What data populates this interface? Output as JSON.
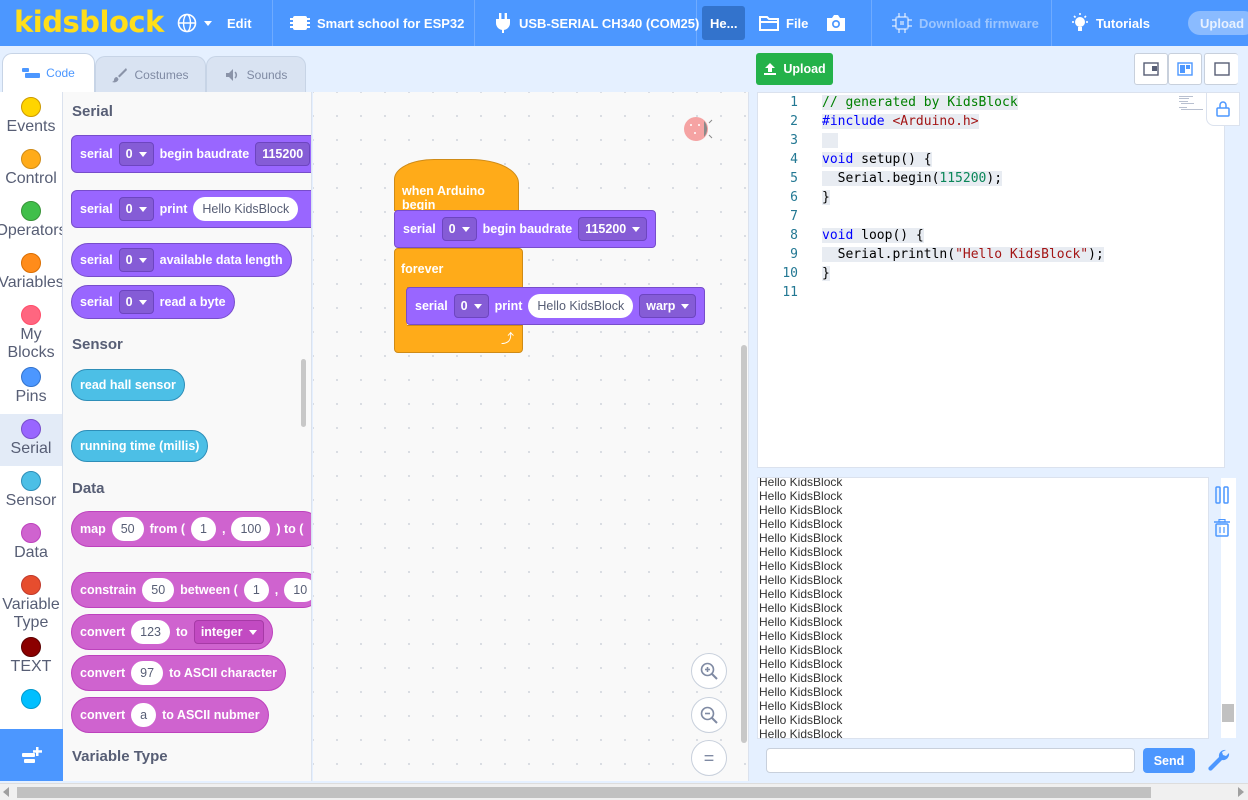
{
  "menubar": {
    "logo": "kidsblock",
    "edit": "Edit",
    "device": "Smart school for ESP32",
    "port": "USB-SERIAL CH340 (COM25)",
    "help": "He...",
    "file": "File",
    "download_firmware": "Download firmware",
    "tutorials": "Tutorials",
    "upload": "Upload",
    "icons": [
      "globe-icon",
      "device-board-icon",
      "usb-plug-icon",
      "folder-icon",
      "camera-icon",
      "chip-icon",
      "lightbulb-icon"
    ]
  },
  "tabs": [
    {
      "label": "Code",
      "icon": "code-icon",
      "active": true
    },
    {
      "label": "Costumes",
      "icon": "brush-icon"
    },
    {
      "label": "Sounds",
      "icon": "speaker-icon"
    }
  ],
  "categories": [
    {
      "label": "Events",
      "color": "#ffd500"
    },
    {
      "label": "Control",
      "color": "#ffab19"
    },
    {
      "label": "Operators",
      "color": "#40bf4a"
    },
    {
      "label": "Variables",
      "color": "#ff8c1a"
    },
    {
      "label": "My Blocks",
      "color": "#ff6680"
    },
    {
      "label": "Pins",
      "color": "#4c97ff"
    },
    {
      "label": "Serial",
      "color": "#9966ff",
      "selected": true
    },
    {
      "label": "Sensor",
      "color": "#4cbfe6"
    },
    {
      "label": "Data",
      "color": "#cf63cf"
    },
    {
      "label": "Variable Type",
      "color": "#e64d2e"
    },
    {
      "label": "TEXT",
      "color": "#8b0000"
    },
    {
      "label": "",
      "color": "#00bfff"
    }
  ],
  "flyout": {
    "serial_heading": "Serial",
    "sensor_heading": "Sensor",
    "data_heading": "Data",
    "vartype_heading": "Variable Type",
    "b_begin": {
      "serial": "serial",
      "port": "0",
      "text": "begin baudrate",
      "baud": "115200"
    },
    "b_print": {
      "serial": "serial",
      "port": "0",
      "text": "print",
      "value": "Hello KidsBlock"
    },
    "b_avail": {
      "serial": "serial",
      "port": "0",
      "text": "available data length"
    },
    "b_read": {
      "serial": "serial",
      "port": "0",
      "text": "read a byte"
    },
    "b_hall": "read hall sensor",
    "b_millis": "running time (millis)",
    "b_map": {
      "label": "map",
      "v": "50",
      "from": "from (",
      "a": "1",
      "comma": ",",
      "b": "100",
      "to": ") to ("
    },
    "b_constrain": {
      "label": "constrain",
      "v": "50",
      "between": "between (",
      "a": "1",
      "comma": ",",
      "b": "10"
    },
    "b_convert": {
      "label": "convert",
      "v": "123",
      "to": "to",
      "type": "integer"
    },
    "b_ascii": {
      "label": "convert",
      "v": "97",
      "text": "to ASCII character"
    },
    "b_asciinum": {
      "label": "convert",
      "v": "a",
      "text": "to ASCII nubmer"
    }
  },
  "workspace": {
    "hat": "when Arduino begin",
    "begin": {
      "serial": "serial",
      "port": "0",
      "text": "begin baudrate",
      "baud": "115200"
    },
    "forever": "forever",
    "print": {
      "serial": "serial",
      "port": "0",
      "text": "print",
      "value": "Hello KidsBlock",
      "mode": "warp"
    },
    "zoom_in": "+",
    "zoom_out": "−",
    "reset": "="
  },
  "toolbar": {
    "upload": "Upload"
  },
  "code": {
    "line_numbers": [
      "1",
      "2",
      "3",
      "4",
      "5",
      "6",
      "7",
      "8",
      "9",
      "10",
      "11"
    ]
  },
  "serial_output": {
    "lines": [
      "Hello KidsBlock",
      "Hello KidsBlock",
      "Hello KidsBlock",
      "Hello KidsBlock",
      "Hello KidsBlock",
      "Hello KidsBlock",
      "Hello KidsBlock",
      "Hello KidsBlock",
      "Hello KidsBlock",
      "Hello KidsBlock",
      "Hello KidsBlock",
      "Hello KidsBlock",
      "Hello KidsBlock",
      "Hello KidsBlock",
      "Hello KidsBlock",
      "Hello KidsBlock",
      "Hello KidsBlock",
      "Hello KidsBlock",
      "Hello KidsBlock"
    ],
    "send": "Send",
    "input_value": ""
  }
}
